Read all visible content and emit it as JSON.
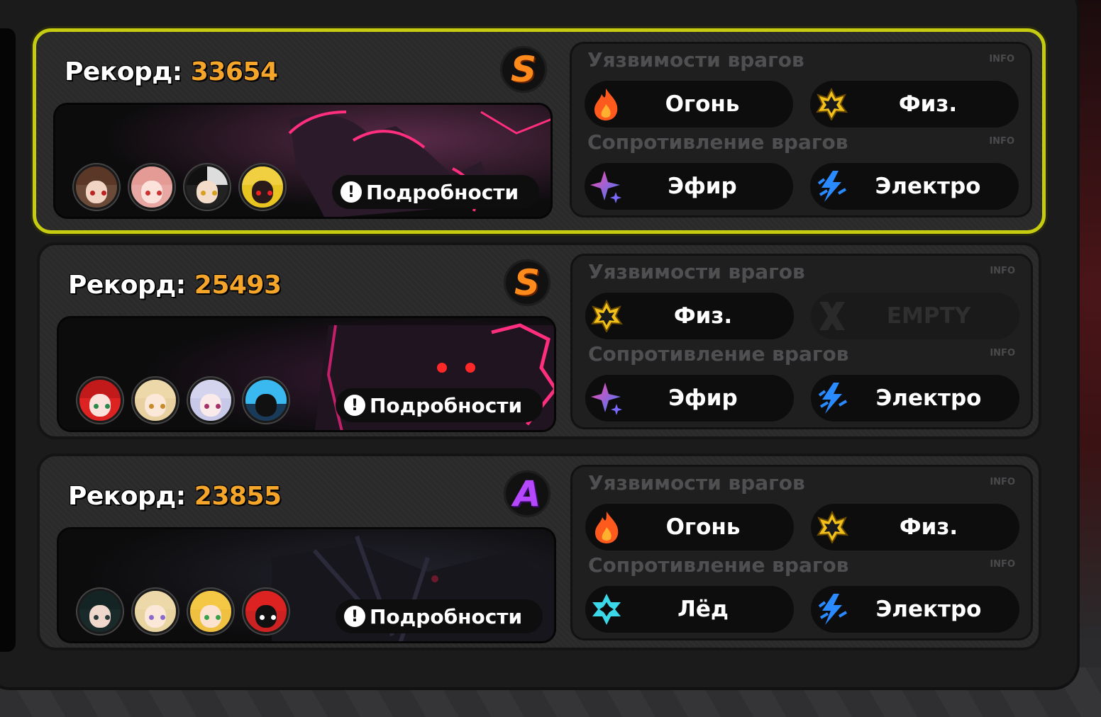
{
  "record_label": "Рекорд:",
  "details_label": "Подробности",
  "vuln_title": "Уязвимости врагов",
  "resist_title": "Сопротивление врагов",
  "info_tag": "INFO",
  "colors": {
    "accent_selected": "#c6cc10",
    "score": "#f4a52a",
    "rank_s": "#ff8a1c",
    "rank_a": "#b548ff"
  },
  "cards": [
    {
      "score": "33654",
      "rank": "S",
      "selected": true,
      "vulnerabilities": [
        {
          "icon": "fire-icon",
          "label": "Огонь"
        },
        {
          "icon": "physical-icon",
          "label": "Физ."
        }
      ],
      "resistances": [
        {
          "icon": "ether-icon",
          "label": "Эфир"
        },
        {
          "icon": "electric-icon",
          "label": "Электро"
        }
      ]
    },
    {
      "score": "25493",
      "rank": "S",
      "selected": false,
      "vulnerabilities": [
        {
          "icon": "physical-icon",
          "label": "Физ."
        },
        {
          "icon": "empty-icon",
          "label": "EMPTY"
        }
      ],
      "resistances": [
        {
          "icon": "ether-icon",
          "label": "Эфир"
        },
        {
          "icon": "electric-icon",
          "label": "Электро"
        }
      ]
    },
    {
      "score": "23855",
      "rank": "A",
      "selected": false,
      "vulnerabilities": [
        {
          "icon": "fire-icon",
          "label": "Огонь"
        },
        {
          "icon": "physical-icon",
          "label": "Физ."
        }
      ],
      "resistances": [
        {
          "icon": "ice-icon",
          "label": "Лёд"
        },
        {
          "icon": "electric-icon",
          "label": "Электро"
        }
      ]
    }
  ]
}
